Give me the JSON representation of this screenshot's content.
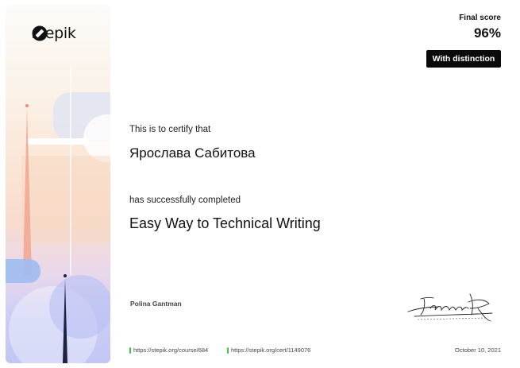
{
  "brand": {
    "name": "stepik",
    "logo_icon": "stepik-logo-icon"
  },
  "score": {
    "label": "Final score",
    "value": "96%",
    "badge": "With distinction"
  },
  "certificate": {
    "intro": "This is to certify that",
    "recipient": "Ярослава Сабитова",
    "completed_text": "has successfully completed",
    "course_title": "Easy Way to Technical Writing"
  },
  "signatory": {
    "name": "Polina Gantman"
  },
  "footer": {
    "course_link": "https://stepik.org/course/684",
    "cert_link": "https://stepik.org/cert/1149076",
    "date": "October 10, 2021",
    "link_marker_color": "#3ec14a"
  }
}
